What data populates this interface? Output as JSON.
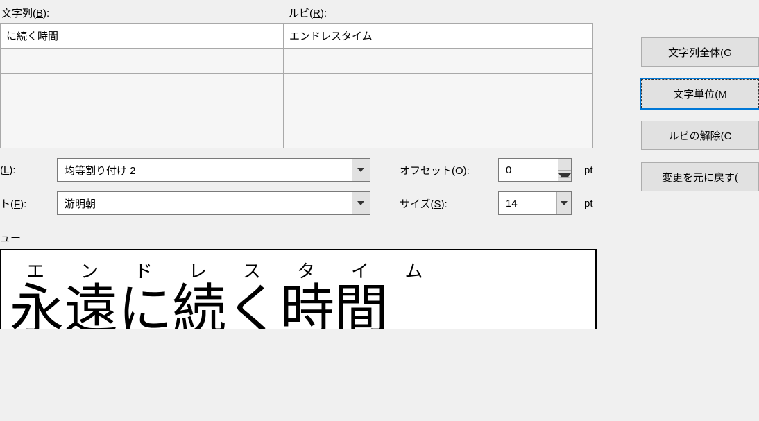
{
  "labels": {
    "base_text": "文字列(",
    "base_text_key": "B",
    "base_text_suffix": "):",
    "ruby": "ルビ(",
    "ruby_key": "R",
    "ruby_suffix": "):",
    "align": "(",
    "align_key": "L",
    "align_suffix": "):",
    "font": "ト(",
    "font_key": "F",
    "font_suffix": "):",
    "offset": "オフセット(",
    "offset_key": "O",
    "offset_suffix": "):",
    "size": "サイズ(",
    "size_key": "S",
    "size_suffix": "):",
    "pt1": "pt",
    "pt2": "pt",
    "preview": "ュー"
  },
  "grid": {
    "row1_base": "に続く時間",
    "row1_ruby": "エンドレスタイム"
  },
  "combos": {
    "align_value": "均等割り付け 2",
    "font_value": "游明朝",
    "offset_value": "0",
    "size_value": "14"
  },
  "buttons": {
    "whole": "文字列全体(G",
    "per_char": "文字単位(M",
    "clear_ruby": "ルビの解除(C",
    "revert": "変更を元に戻す("
  },
  "preview": {
    "ruby_text": "エンドレスタイム",
    "base_text": "永遠に続く時間"
  }
}
